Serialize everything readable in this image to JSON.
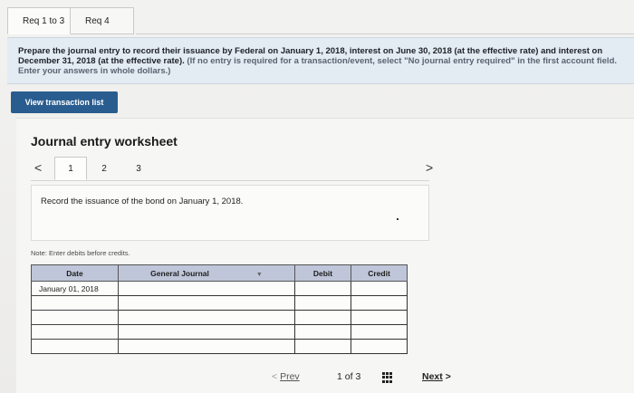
{
  "tabs": [
    "Req 1 to 3",
    "Req 4"
  ],
  "instructions": {
    "main": "Prepare the journal entry to record their issuance by Federal on January 1, 2018, interest on June 30, 2018 (at the effective rate) and interest on December 31, 2018 (at the effective rate).",
    "note": "(If no entry is required for a transaction/event, select \"No journal entry required\" in the first account field. Enter your answers in whole dollars.)"
  },
  "view_transaction_button": "View transaction list",
  "worksheet": {
    "title": "Journal entry worksheet",
    "left_arrow": "<",
    "right_arrow": ">",
    "steps": [
      "1",
      "2",
      "3"
    ],
    "record_text": "Record the issuance of the bond on January 1, 2018.",
    "note": "Note: Enter debits before credits."
  },
  "table": {
    "headers": {
      "date": "Date",
      "general_journal": "General Journal",
      "debit": "Debit",
      "credit": "Credit"
    },
    "rows": [
      {
        "date": "January 01, 2018",
        "account": "",
        "debit": "",
        "credit": ""
      },
      {
        "date": "",
        "account": "",
        "debit": "",
        "credit": ""
      },
      {
        "date": "",
        "account": "",
        "debit": "",
        "credit": ""
      },
      {
        "date": "",
        "account": "",
        "debit": "",
        "credit": ""
      },
      {
        "date": "",
        "account": "",
        "debit": "",
        "credit": ""
      }
    ]
  },
  "pagination": {
    "prev_arrow": "<",
    "prev_label": "Prev",
    "current": "1",
    "of_label": "of",
    "total": "3",
    "next_label": "Next",
    "next_arrow": ">"
  }
}
